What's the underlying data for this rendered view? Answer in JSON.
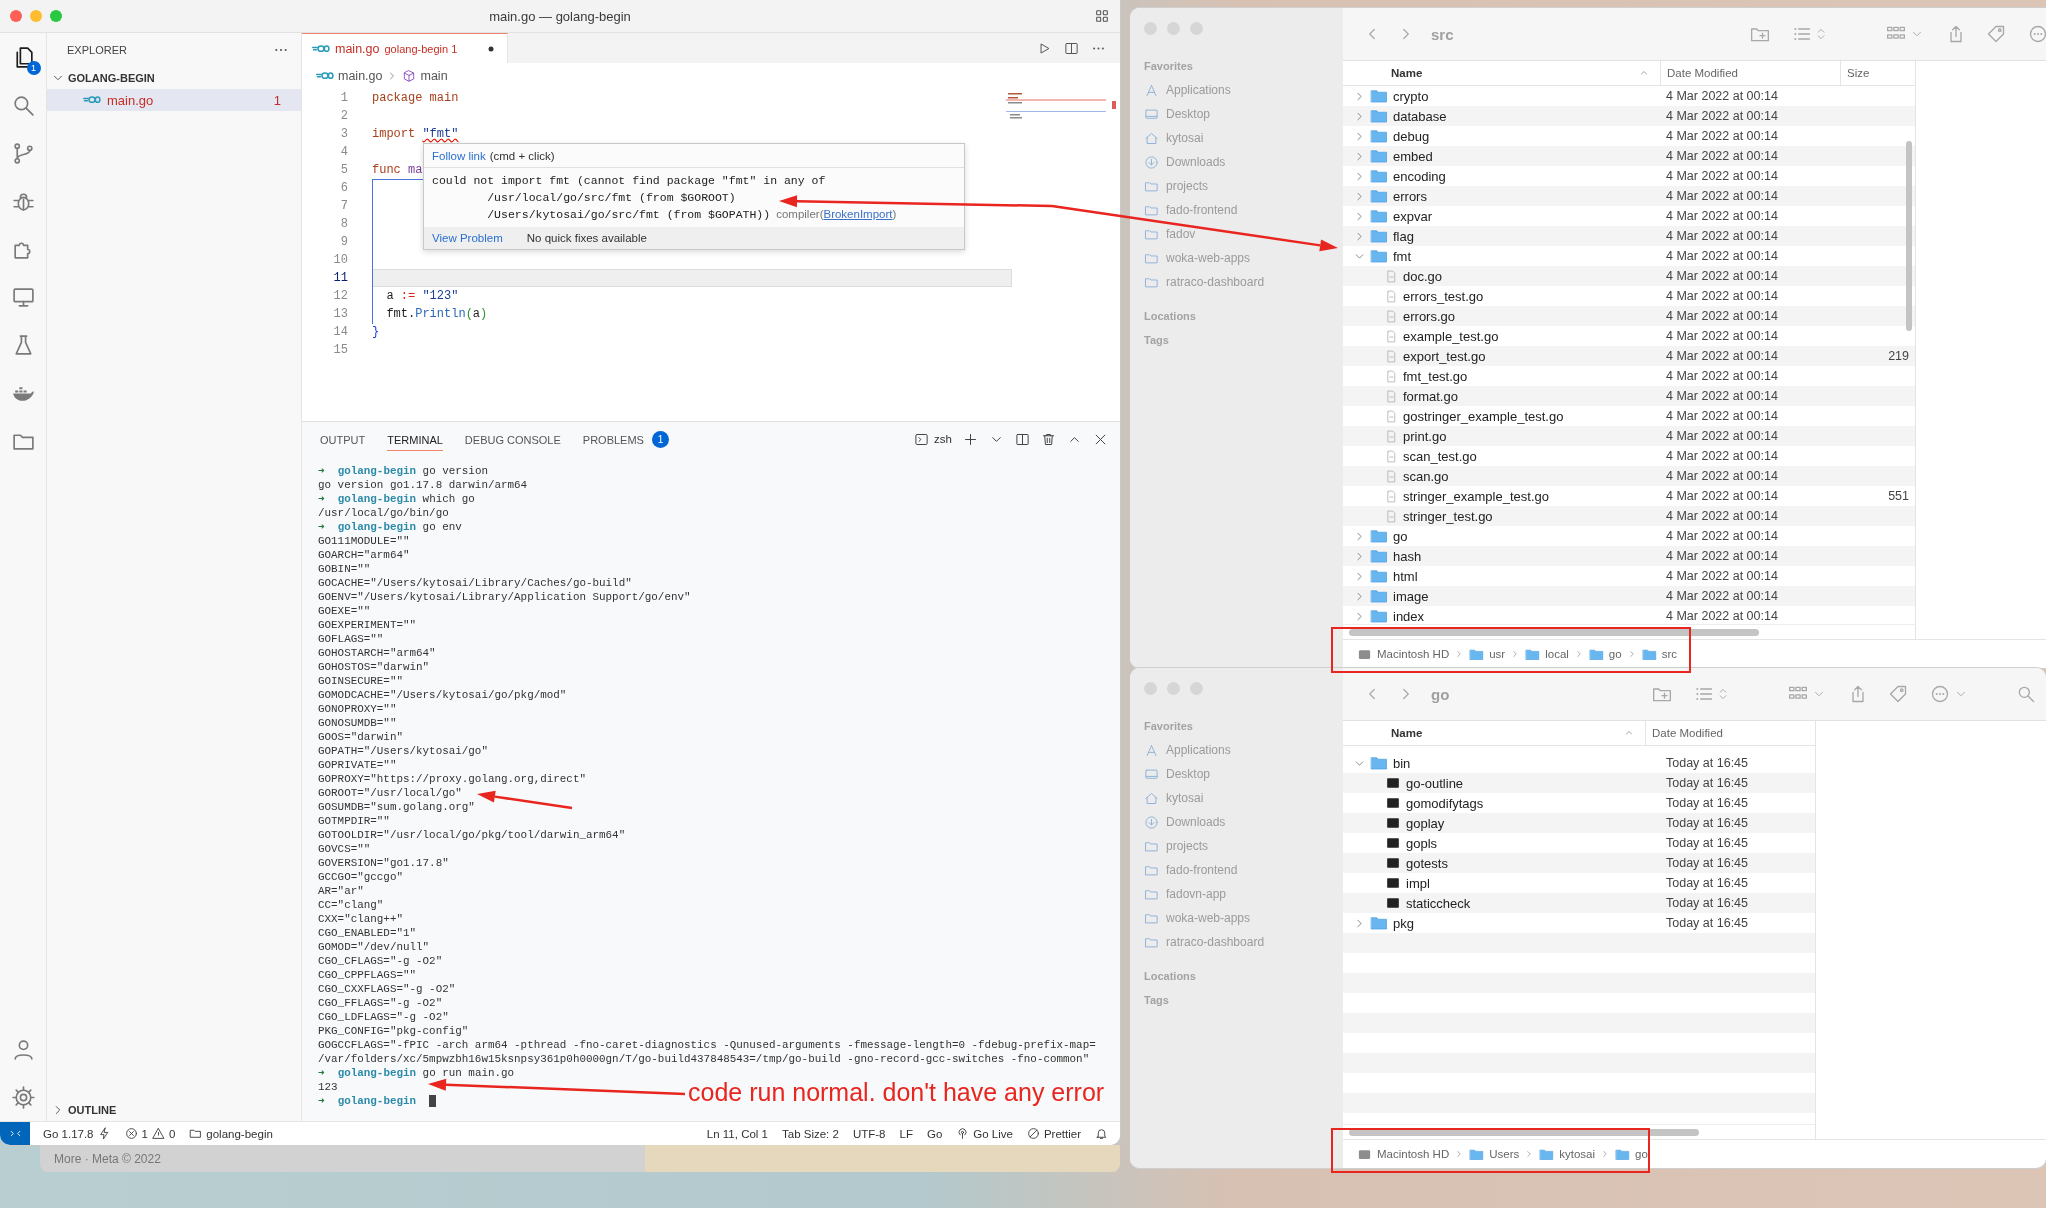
{
  "vscode": {
    "title": "main.go — golang-begin",
    "activity_bar": [
      {
        "kind": "explorer",
        "selected": true,
        "badge": "1"
      },
      {
        "kind": "search",
        "selected": false
      },
      {
        "kind": "source-control",
        "selected": false
      },
      {
        "kind": "debug",
        "selected": false
      },
      {
        "kind": "extensions",
        "selected": false
      },
      {
        "kind": "remote-explorer",
        "selected": false
      },
      {
        "kind": "testing",
        "selected": false
      },
      {
        "kind": "docker",
        "selected": false
      },
      {
        "kind": "project-manager",
        "selected": false
      }
    ],
    "activity_bar_bottom": [
      {
        "kind": "accounts",
        "selected": false
      },
      {
        "kind": "manage",
        "selected": false
      }
    ],
    "explorer": {
      "title": "EXPLORER",
      "folder": {
        "label": "GOLANG-BEGIN",
        "expanded": true,
        "files": [
          {
            "name": "main.go",
            "problems": "1",
            "selected": true
          }
        ]
      },
      "outline": {
        "label": "OUTLINE",
        "expanded": false
      }
    },
    "tabs": [
      {
        "name": "main.go",
        "detail": "golang-begin 1",
        "modified": true,
        "selected": true
      }
    ],
    "breadcrumb": [
      {
        "kind": "file",
        "text": "main.go"
      },
      {
        "kind": "package",
        "text": "main"
      }
    ],
    "code": [
      {
        "number": "1",
        "current": false,
        "tokens": [
          {
            "kind": "keyword",
            "text": "package main"
          }
        ]
      },
      {
        "number": "2",
        "current": false
      },
      {
        "number": "3",
        "current": false,
        "tokens": [
          {
            "kind": "keyword",
            "text": "import "
          },
          {
            "kind": "error-string",
            "text": "\"fmt\""
          }
        ]
      },
      {
        "number": "4",
        "current": false
      },
      {
        "number": "5",
        "current": false,
        "tokens": [
          {
            "kind": "keyword",
            "text": "func "
          },
          {
            "kind": "function-name",
            "text": "ma"
          }
        ]
      },
      {
        "number": "6",
        "current": false
      },
      {
        "number": "7",
        "current": false
      },
      {
        "number": "8",
        "current": false
      },
      {
        "number": "9",
        "current": false
      },
      {
        "number": "10",
        "current": false
      },
      {
        "number": "11",
        "current": true
      },
      {
        "number": "12",
        "current": false,
        "tokens": [
          {
            "kind": "plain",
            "text": "  a "
          },
          {
            "kind": "operator",
            "text": ":= "
          },
          {
            "kind": "string",
            "text": "\"123\""
          }
        ]
      },
      {
        "number": "13",
        "current": false,
        "tokens": [
          {
            "kind": "plain",
            "text": "  fmt."
          },
          {
            "kind": "function",
            "text": "Println"
          },
          {
            "kind": "punct",
            "text": "("
          },
          {
            "kind": "plain",
            "text": "a"
          },
          {
            "kind": "punct",
            "text": ")"
          }
        ]
      },
      {
        "number": "14",
        "current": false,
        "tokens": [
          {
            "kind": "bracket",
            "text": "}"
          }
        ]
      },
      {
        "number": "15",
        "current": false
      }
    ],
    "hover": {
      "link": "Follow link",
      "hint": "(cmd + click)",
      "message_lines": [
        "could not import fmt (cannot find package \"fmt\" in any of",
        "\t/usr/local/go/src/fmt (from $GOROOT)",
        "\t/Users/kytosai/go/src/fmt (from $GOPATH))"
      ],
      "source": "compiler(",
      "code": "BrokenImport",
      "source_close": ")",
      "action": "View Problem",
      "note": "No quick fixes available"
    },
    "panel": {
      "tabs": [
        {
          "label": "OUTPUT",
          "selected": false
        },
        {
          "label": "TERMINAL",
          "selected": true
        },
        {
          "label": "DEBUG CONSOLE",
          "selected": false
        },
        {
          "label": "PROBLEMS",
          "selected": false,
          "badge": "1"
        }
      ],
      "shell": "zsh",
      "prompt_symbol": "➜",
      "terminal": [
        {
          "kind": "prompt",
          "dir": "golang-begin",
          "command": "go version"
        },
        {
          "kind": "output",
          "text": "go version go1.17.8 darwin/arm64"
        },
        {
          "kind": "prompt",
          "dir": "golang-begin",
          "command": "which go"
        },
        {
          "kind": "output",
          "text": "/usr/local/go/bin/go"
        },
        {
          "kind": "prompt",
          "dir": "golang-begin",
          "command": "go env"
        },
        {
          "kind": "output",
          "text": "GO111MODULE=\"\""
        },
        {
          "kind": "output",
          "text": "GOARCH=\"arm64\""
        },
        {
          "kind": "output",
          "text": "GOBIN=\"\""
        },
        {
          "kind": "output",
          "text": "GOCACHE=\"/Users/kytosai/Library/Caches/go-build\""
        },
        {
          "kind": "output",
          "text": "GOENV=\"/Users/kytosai/Library/Application Support/go/env\""
        },
        {
          "kind": "output",
          "text": "GOEXE=\"\""
        },
        {
          "kind": "output",
          "text": "GOEXPERIMENT=\"\""
        },
        {
          "kind": "output",
          "text": "GOFLAGS=\"\""
        },
        {
          "kind": "output",
          "text": "GOHOSTARCH=\"arm64\""
        },
        {
          "kind": "output",
          "text": "GOHOSTOS=\"darwin\""
        },
        {
          "kind": "output",
          "text": "GOINSECURE=\"\""
        },
        {
          "kind": "output",
          "text": "GOMODCACHE=\"/Users/kytosai/go/pkg/mod\""
        },
        {
          "kind": "output",
          "text": "GONOPROXY=\"\""
        },
        {
          "kind": "output",
          "text": "GONOSUMDB=\"\""
        },
        {
          "kind": "output",
          "text": "GOOS=\"darwin\""
        },
        {
          "kind": "output",
          "text": "GOPATH=\"/Users/kytosai/go\""
        },
        {
          "kind": "output",
          "text": "GOPRIVATE=\"\""
        },
        {
          "kind": "output",
          "text": "GOPROXY=\"https://proxy.golang.org,direct\""
        },
        {
          "kind": "output",
          "text": "GOROOT=\"/usr/local/go\""
        },
        {
          "kind": "output",
          "text": "GOSUMDB=\"sum.golang.org\""
        },
        {
          "kind": "output",
          "text": "GOTMPDIR=\"\""
        },
        {
          "kind": "output",
          "text": "GOTOOLDIR=\"/usr/local/go/pkg/tool/darwin_arm64\""
        },
        {
          "kind": "output",
          "text": "GOVCS=\"\""
        },
        {
          "kind": "output",
          "text": "GOVERSION=\"go1.17.8\""
        },
        {
          "kind": "output",
          "text": "GCCGO=\"gccgo\""
        },
        {
          "kind": "output",
          "text": "AR=\"ar\""
        },
        {
          "kind": "output",
          "text": "CC=\"clang\""
        },
        {
          "kind": "output",
          "text": "CXX=\"clang++\""
        },
        {
          "kind": "output",
          "text": "CGO_ENABLED=\"1\""
        },
        {
          "kind": "output",
          "text": "GOMOD=\"/dev/null\""
        },
        {
          "kind": "output",
          "text": "CGO_CFLAGS=\"-g -O2\""
        },
        {
          "kind": "output",
          "text": "CGO_CPPFLAGS=\"\""
        },
        {
          "kind": "output",
          "text": "CGO_CXXFLAGS=\"-g -O2\""
        },
        {
          "kind": "output",
          "text": "CGO_FFLAGS=\"-g -O2\""
        },
        {
          "kind": "output",
          "text": "CGO_LDFLAGS=\"-g -O2\""
        },
        {
          "kind": "output",
          "text": "PKG_CONFIG=\"pkg-config\""
        },
        {
          "kind": "output",
          "text": "GOGCCFLAGS=\"-fPIC -arch arm64 -pthread -fno-caret-diagnostics -Qunused-arguments -fmessage-length=0 -fdebug-prefix-map="
        },
        {
          "kind": "output",
          "text": "/var/folders/xc/5mpwzbh16w15ksnpsy361p0h0000gn/T/go-build437848543=/tmp/go-build -gno-record-gcc-switches -fno-common\""
        },
        {
          "kind": "prompt",
          "dir": "golang-begin",
          "command": "go run main.go"
        },
        {
          "kind": "output",
          "text": "123"
        },
        {
          "kind": "input",
          "dir": "golang-begin"
        }
      ]
    },
    "status_bar": {
      "left": [
        {
          "kind": "remote"
        },
        {
          "kind": "go-version",
          "text": "Go 1.17.8"
        },
        {
          "kind": "problems",
          "errors": "1",
          "warnings": "0"
        },
        {
          "kind": "folder",
          "text": "golang-begin"
        }
      ],
      "right": [
        {
          "kind": "text",
          "text": "Ln 11, Col 1"
        },
        {
          "kind": "text",
          "text": "Tab Size: 2"
        },
        {
          "kind": "text",
          "text": "UTF-8"
        },
        {
          "kind": "text",
          "text": "LF"
        },
        {
          "kind": "text",
          "text": "Go"
        },
        {
          "kind": "live",
          "text": "Go Live"
        },
        {
          "kind": "prettier",
          "text": "Prettier"
        },
        {
          "kind": "notifications"
        }
      ]
    }
  },
  "background_window": {
    "text": "More · Meta © 2022"
  },
  "finders": [
    {
      "title": "src",
      "sidebar": {
        "favorites": "Favorites",
        "items": [
          {
            "kind": "applications",
            "label": "Applications"
          },
          {
            "kind": "desktop",
            "label": "Desktop"
          },
          {
            "kind": "home",
            "label": "kytosai"
          },
          {
            "kind": "downloads",
            "label": "Downloads"
          },
          {
            "kind": "folder",
            "label": "projects"
          },
          {
            "kind": "folder",
            "label": "fado-frontend"
          },
          {
            "kind": "folder",
            "label": "fadov"
          },
          {
            "kind": "folder",
            "label": "woka-web-apps"
          },
          {
            "kind": "folder",
            "label": "ratraco-dashboard"
          }
        ],
        "locations": "Locations",
        "tags": "Tags"
      },
      "columns": [
        {
          "label": "Name",
          "sorted": true
        },
        {
          "label": "Date Modified",
          "sorted": false
        },
        {
          "label": "Size",
          "sorted": false
        }
      ],
      "rows": [
        {
          "kind": "folder",
          "name": "crypto",
          "date": "4 Mar 2022 at 00:14",
          "expanded": false
        },
        {
          "kind": "folder",
          "name": "database",
          "date": "4 Mar 2022 at 00:14",
          "expanded": false
        },
        {
          "kind": "folder",
          "name": "debug",
          "date": "4 Mar 2022 at 00:14",
          "expanded": false
        },
        {
          "kind": "folder",
          "name": "embed",
          "date": "4 Mar 2022 at 00:14",
          "expanded": false
        },
        {
          "kind": "folder",
          "name": "encoding",
          "date": "4 Mar 2022 at 00:14",
          "expanded": false
        },
        {
          "kind": "folder",
          "name": "errors",
          "date": "4 Mar 2022 at 00:14",
          "expanded": false
        },
        {
          "kind": "folder",
          "name": "expvar",
          "date": "4 Mar 2022 at 00:14",
          "expanded": false
        },
        {
          "kind": "folder",
          "name": "flag",
          "date": "4 Mar 2022 at 00:14",
          "expanded": false
        },
        {
          "kind": "folder",
          "name": "fmt",
          "date": "4 Mar 2022 at 00:14",
          "expanded": true,
          "children": [
            {
              "kind": "file",
              "name": "doc.go",
              "date": "4 Mar 2022 at 00:14"
            },
            {
              "kind": "file",
              "name": "errors_test.go",
              "date": "4 Mar 2022 at 00:14"
            },
            {
              "kind": "file",
              "name": "errors.go",
              "date": "4 Mar 2022 at 00:14"
            },
            {
              "kind": "file",
              "name": "example_test.go",
              "date": "4 Mar 2022 at 00:14"
            },
            {
              "kind": "file",
              "name": "export_test.go",
              "date": "4 Mar 2022 at 00:14",
              "size": "219"
            },
            {
              "kind": "file",
              "name": "fmt_test.go",
              "date": "4 Mar 2022 at 00:14"
            },
            {
              "kind": "file",
              "name": "format.go",
              "date": "4 Mar 2022 at 00:14"
            },
            {
              "kind": "file",
              "name": "gostringer_example_test.go",
              "date": "4 Mar 2022 at 00:14"
            },
            {
              "kind": "file",
              "name": "print.go",
              "date": "4 Mar 2022 at 00:14"
            },
            {
              "kind": "file",
              "name": "scan_test.go",
              "date": "4 Mar 2022 at 00:14"
            },
            {
              "kind": "file",
              "name": "scan.go",
              "date": "4 Mar 2022 at 00:14"
            },
            {
              "kind": "file",
              "name": "stringer_example_test.go",
              "date": "4 Mar 2022 at 00:14",
              "size": "551"
            },
            {
              "kind": "file",
              "name": "stringer_test.go",
              "date": "4 Mar 2022 at 00:14"
            }
          ]
        },
        {
          "kind": "folder",
          "name": "go",
          "date": "4 Mar 2022 at 00:14",
          "expanded": false
        },
        {
          "kind": "folder",
          "name": "hash",
          "date": "4 Mar 2022 at 00:14",
          "expanded": false
        },
        {
          "kind": "folder",
          "name": "html",
          "date": "4 Mar 2022 at 00:14",
          "expanded": false
        },
        {
          "kind": "folder",
          "name": "image",
          "date": "4 Mar 2022 at 00:14",
          "expanded": false
        },
        {
          "kind": "folder",
          "name": "index",
          "date": "4 Mar 2022 at 00:14",
          "expanded": false
        }
      ],
      "path": [
        {
          "kind": "disk",
          "label": "Macintosh HD"
        },
        {
          "kind": "folder",
          "label": "usr"
        },
        {
          "kind": "folder",
          "label": "local"
        },
        {
          "kind": "folder",
          "label": "go"
        },
        {
          "kind": "folder",
          "label": "src"
        }
      ]
    },
    {
      "title": "go",
      "sidebar": {
        "favorites": "Favorites",
        "items": [
          {
            "kind": "applications",
            "label": "Applications"
          },
          {
            "kind": "desktop",
            "label": "Desktop"
          },
          {
            "kind": "home",
            "label": "kytosai"
          },
          {
            "kind": "downloads",
            "label": "Downloads"
          },
          {
            "kind": "folder",
            "label": "projects"
          },
          {
            "kind": "folder",
            "label": "fado-frontend"
          },
          {
            "kind": "folder",
            "label": "fadovn-app"
          },
          {
            "kind": "folder",
            "label": "woka-web-apps"
          },
          {
            "kind": "folder",
            "label": "ratraco-dashboard"
          }
        ],
        "locations": "Locations",
        "tags": "Tags"
      },
      "columns": [
        {
          "label": "Name",
          "sorted": true
        },
        {
          "label": "Date Modified",
          "sorted": false
        }
      ],
      "rows": [
        {
          "kind": "folder",
          "name": "bin",
          "date": "Today at 16:45",
          "expanded": true,
          "children": [
            {
              "kind": "exec",
              "name": "go-outline",
              "date": "Today at 16:45"
            },
            {
              "kind": "exec",
              "name": "gomodifytags",
              "date": "Today at 16:45"
            },
            {
              "kind": "exec",
              "name": "goplay",
              "date": "Today at 16:45"
            },
            {
              "kind": "exec",
              "name": "gopls",
              "date": "Today at 16:45"
            },
            {
              "kind": "exec",
              "name": "gotests",
              "date": "Today at 16:45"
            },
            {
              "kind": "exec",
              "name": "impl",
              "date": "Today at 16:45"
            },
            {
              "kind": "exec",
              "name": "staticcheck",
              "date": "Today at 16:45"
            }
          ]
        },
        {
          "kind": "folder",
          "name": "pkg",
          "date": "Today at 16:45",
          "expanded": false
        }
      ],
      "path": [
        {
          "kind": "disk",
          "label": "Macintosh HD"
        },
        {
          "kind": "folder",
          "label": "Users"
        },
        {
          "kind": "folder",
          "label": "kytosai"
        },
        {
          "kind": "folder",
          "label": "go"
        }
      ]
    }
  ],
  "annotations": {
    "note": "code run normal. don't have any error"
  }
}
